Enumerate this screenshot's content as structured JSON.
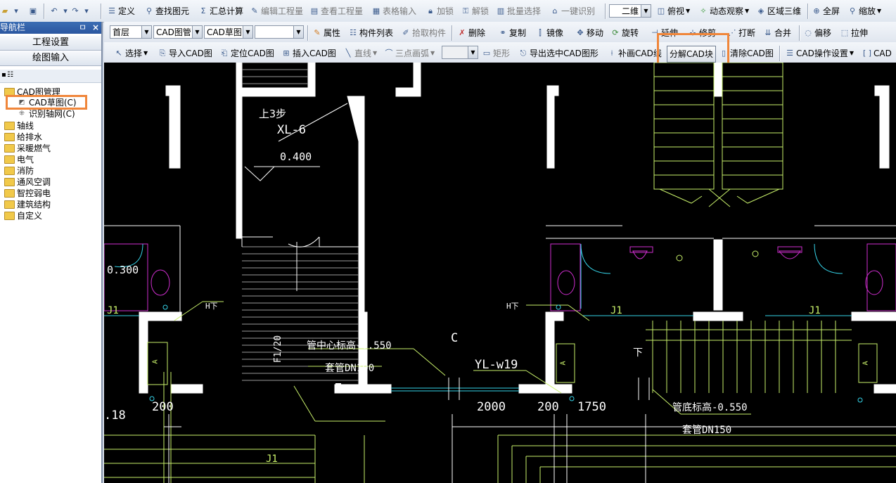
{
  "topbar": {
    "items": [
      "定义",
      "查找图元",
      "汇总计算",
      "编辑工程量",
      "查看工程量",
      "表格输入",
      "加锁",
      "解锁",
      "批量选择",
      "一键识别",
      "二维",
      "俯视",
      "动态观察",
      "区域三维",
      "全屏",
      "缩放"
    ]
  },
  "nav": {
    "title": "导航栏",
    "pin": "ㅁ",
    "close": "×",
    "buttons": [
      "工程设置",
      "绘图输入"
    ],
    "tree": {
      "root": "CAD图管理",
      "children": [
        "CAD草图(C)",
        "识别轴网(C)"
      ],
      "folders": [
        "轴线",
        "给排水",
        "采暖燃气",
        "电气",
        "消防",
        "通风空调",
        "智控弱电",
        "建筑结构",
        "自定义"
      ]
    }
  },
  "toolbar2": {
    "floor": "首层",
    "category": "CAD图管",
    "subcategory": "CAD草图",
    "blank": "",
    "buttons": [
      "属性",
      "构件列表",
      "拾取构件",
      "删除",
      "复制",
      "镜像",
      "移动",
      "旋转",
      "延伸",
      "修剪",
      "打断",
      "合并",
      "偏移",
      "拉伸"
    ]
  },
  "toolbar3": {
    "buttons": [
      "选择",
      "导入CAD图",
      "定位CAD图",
      "插入CAD图",
      "直线",
      "三点画弧",
      "矩形",
      "导出选中CAD图形",
      "补画CAD线",
      "分解CAD块",
      "清除CAD图",
      "CAD操作设置",
      "CAD"
    ],
    "highlighted": "分解CAD块"
  },
  "drawing": {
    "labels": [
      "上3步",
      "XL-6",
      "0.400",
      "0.300",
      "J1",
      "H下",
      "管中心标高-0.550",
      "套管DN100",
      "F1/20",
      "C",
      "YL-w19",
      "2000",
      "200",
      "1750",
      "管底标高-0.550",
      "套管DN150",
      "200",
      ".18",
      "J1",
      "H下",
      "J1",
      "A",
      "J1",
      "下",
      "A",
      "A"
    ]
  },
  "colors": {
    "highlight": "#f0863a",
    "cad_bg": "#000000",
    "nav_title": "#2a56a0"
  }
}
